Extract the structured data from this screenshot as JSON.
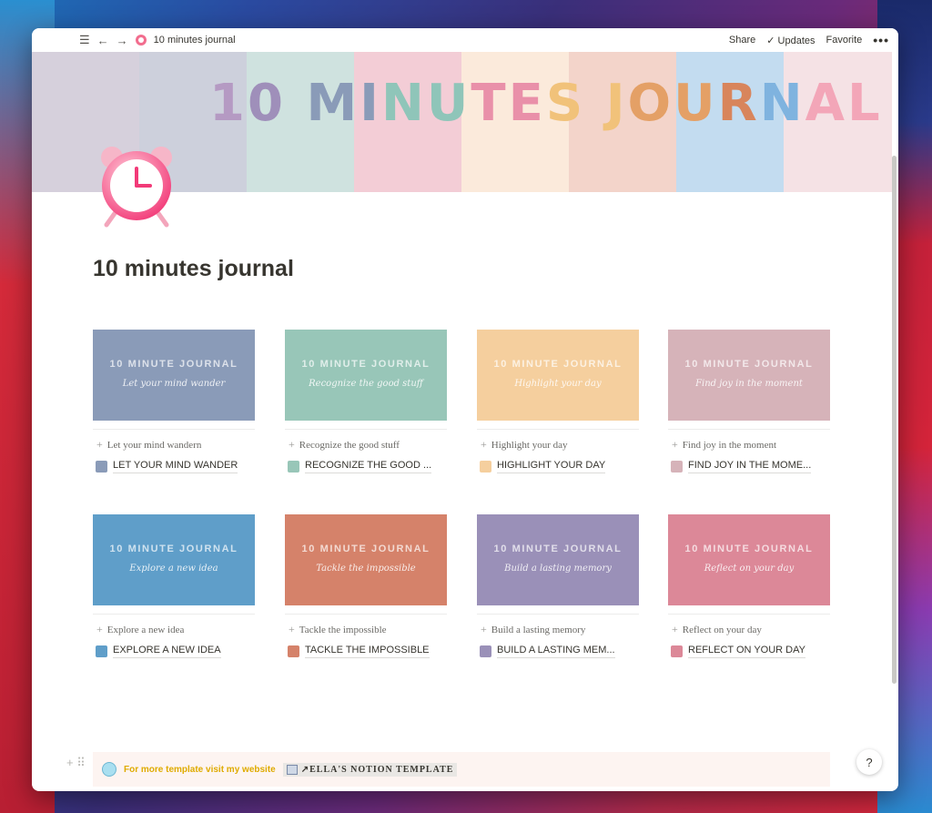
{
  "window": {
    "breadcrumb": "10 minutes journal",
    "share_label": "Share",
    "updates_label": "Updates",
    "favorite_label": "Favorite",
    "more_label": "•••"
  },
  "cover": {
    "stripes": [
      "#d6d0dc",
      "#cdd0dc",
      "#cfe2df",
      "#f3cdd6",
      "#fbeadb",
      "#f3d4ca",
      "#c3dcf0",
      "#f5e2e5"
    ],
    "title_letters": [
      {
        "ch": "1",
        "color": "#b59ac3"
      },
      {
        "ch": "0",
        "color": "#9f8fba"
      },
      {
        "ch": " ",
        "color": "#000"
      },
      {
        "ch": "M",
        "color": "#8a9bb8"
      },
      {
        "ch": "I",
        "color": "#8a9bb8"
      },
      {
        "ch": "N",
        "color": "#8fc5b9"
      },
      {
        "ch": "U",
        "color": "#8fc5b9"
      },
      {
        "ch": "T",
        "color": "#e990a9"
      },
      {
        "ch": "E",
        "color": "#e990a9"
      },
      {
        "ch": "S",
        "color": "#f1c27a"
      },
      {
        "ch": " ",
        "color": "#000"
      },
      {
        "ch": "J",
        "color": "#f1c27a"
      },
      {
        "ch": "O",
        "color": "#e4a066"
      },
      {
        "ch": "U",
        "color": "#e4a066"
      },
      {
        "ch": "R",
        "color": "#d8855c"
      },
      {
        "ch": "N",
        "color": "#7fb3df"
      },
      {
        "ch": "A",
        "color": "#f3a6b8"
      },
      {
        "ch": "L",
        "color": "#f3a6b8"
      }
    ]
  },
  "page": {
    "title": "10 minutes journal"
  },
  "gallery": {
    "cards": [
      {
        "name": "Let your mind wandern",
        "prop": "LET YOUR MIND WANDER",
        "thumb_head": "10 MINUTE JOURNAL",
        "thumb_script": "Let your mind wander",
        "color": "#8a9bb8"
      },
      {
        "name": "Recognize the good stuff",
        "prop": "RECOGNIZE THE GOOD ...",
        "thumb_head": "10 MINUTE JOURNAL",
        "thumb_script": "Recognize the good stuff",
        "color": "#98c6b8"
      },
      {
        "name": "Highlight your day",
        "prop": "HIGHLIGHT YOUR DAY",
        "thumb_head": "10 MINUTE JOURNAL",
        "thumb_script": "Highlight your day",
        "color": "#f5cf9e"
      },
      {
        "name": "Find joy in the moment",
        "prop": "FIND JOY IN THE MOME...",
        "thumb_head": "10 MINUTE JOURNAL",
        "thumb_script": "Find joy in the moment",
        "color": "#d6b3b9"
      },
      {
        "name": "Explore a new idea",
        "prop": "EXPLORE A NEW IDEA",
        "thumb_head": "10 MINUTE JOURNAL",
        "thumb_script": "Explore a new idea",
        "color": "#5f9ec9"
      },
      {
        "name": "Tackle the impossible",
        "prop": "TACKLE THE IMPOSSIBLE",
        "thumb_head": "10 MINUTE JOURNAL",
        "thumb_script": "Tackle the impossible",
        "color": "#d5826a"
      },
      {
        "name": "Build a lasting memory",
        "prop": "BUILD A LASTING MEM...",
        "thumb_head": "10 MINUTE JOURNAL",
        "thumb_script": "Build a lasting memory",
        "color": "#9a90b8"
      },
      {
        "name": "Reflect on your day",
        "prop": "REFLECT ON YOUR DAY",
        "thumb_head": "10 MINUTE JOURNAL",
        "thumb_script": "Reflect on your day",
        "color": "#dc8898"
      }
    ]
  },
  "callout": {
    "text": "For more template visit my website",
    "link_text": "↗ELLA'S   NOTION   TEMPLATE"
  },
  "help_label": "?"
}
